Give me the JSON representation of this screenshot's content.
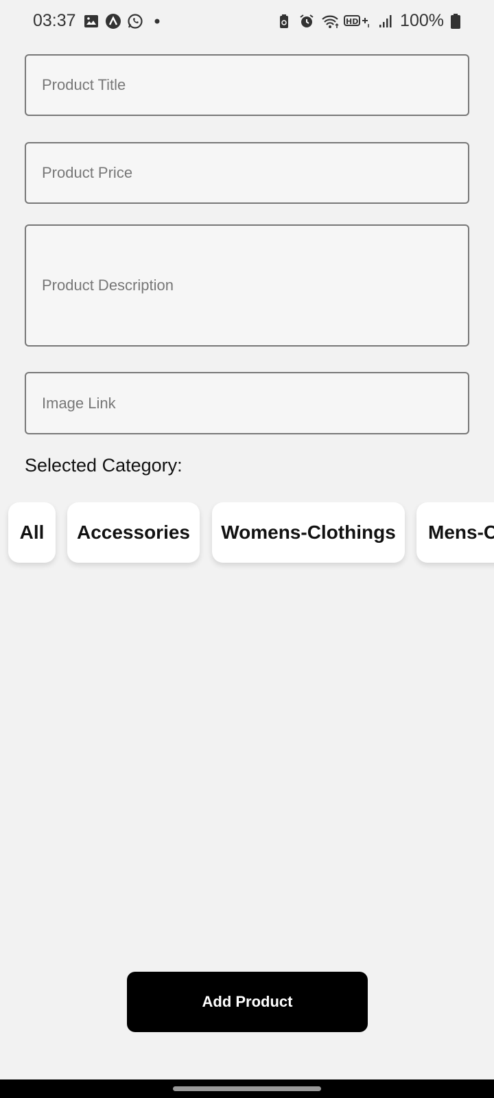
{
  "status_bar": {
    "time": "03:37",
    "battery": "100%",
    "left_icons": [
      "gallery-icon",
      "aurora-icon",
      "whatsapp-icon",
      "dot-icon"
    ],
    "right_icons": [
      "battery-saver-icon",
      "alarm-icon",
      "wifi-icon",
      "hd-plus-icon",
      "signal-icon",
      "battery-icon"
    ]
  },
  "form": {
    "title_placeholder": "Product Title",
    "price_placeholder": "Product Price",
    "description_placeholder": "Product Description",
    "image_placeholder": "Image Link"
  },
  "category": {
    "label": "Selected Category:",
    "chips": [
      "All",
      "Accessories",
      "Womens-Clothings",
      "Mens-Clothings"
    ]
  },
  "actions": {
    "add_label": "Add Product"
  }
}
